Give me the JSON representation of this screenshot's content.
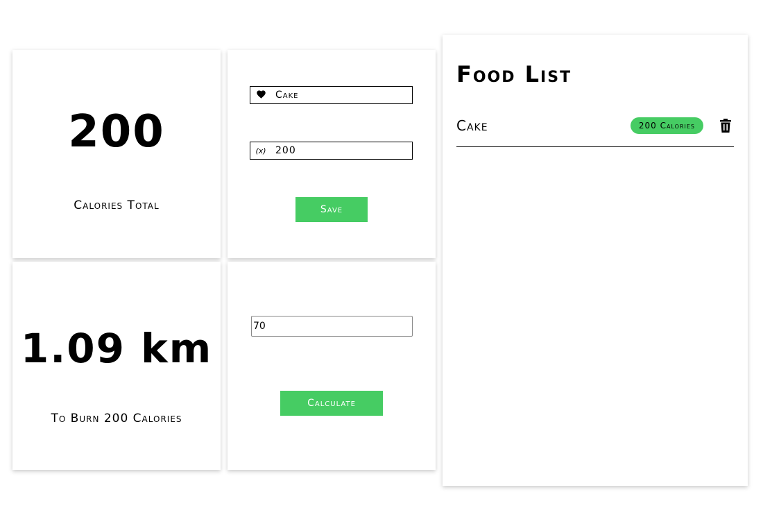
{
  "total": {
    "value": "200",
    "label": "Calories Total"
  },
  "form": {
    "food_name_icon": "heart-icon",
    "food_name_value": "Cake",
    "calories_icon": "variable-icon",
    "calories_icon_text": "(x)",
    "calories_value": "200",
    "save_label": "Save"
  },
  "distance": {
    "value": "1.09 km",
    "label": "To Burn 200 Calories"
  },
  "calculator": {
    "weight_value": "70",
    "calculate_label": "Calculate"
  },
  "food_list": {
    "title": "Food List",
    "items": [
      {
        "name": "Cake",
        "calories_badge": "200 Calories",
        "delete_icon": "trash-icon"
      }
    ]
  },
  "colors": {
    "accent": "#46cc63",
    "text": "#000000",
    "background": "#ffffff"
  }
}
